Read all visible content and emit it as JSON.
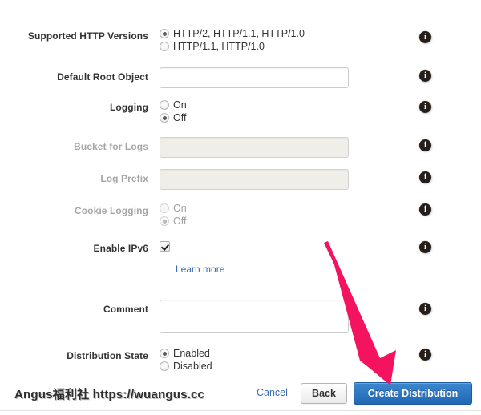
{
  "form": {
    "rows": [
      {
        "id": "supported-http-versions",
        "label": "Supported HTTP Versions",
        "type": "radio",
        "disabled": false,
        "options": [
          {
            "label": "HTTP/2, HTTP/1.1, HTTP/1.0",
            "selected": true
          },
          {
            "label": "HTTP/1.1, HTTP/1.0",
            "selected": false
          }
        ]
      },
      {
        "id": "default-root-object",
        "label": "Default Root Object",
        "type": "text",
        "value": "",
        "placeholder": "",
        "disabled": false
      },
      {
        "id": "logging",
        "label": "Logging",
        "type": "radio",
        "disabled": false,
        "options": [
          {
            "label": "On",
            "selected": false
          },
          {
            "label": "Off",
            "selected": true
          }
        ]
      },
      {
        "id": "bucket-for-logs",
        "label": "Bucket for Logs",
        "type": "text",
        "value": "",
        "placeholder": "",
        "disabled": true
      },
      {
        "id": "log-prefix",
        "label": "Log Prefix",
        "type": "text",
        "value": "",
        "placeholder": "",
        "disabled": true
      },
      {
        "id": "cookie-logging",
        "label": "Cookie Logging",
        "type": "radio",
        "disabled": true,
        "options": [
          {
            "label": "On",
            "selected": false
          },
          {
            "label": "Off",
            "selected": true
          }
        ]
      },
      {
        "id": "enable-ipv6",
        "label": "Enable IPv6",
        "type": "checkbox",
        "checked": true,
        "disabled": false,
        "help_link": "Learn more"
      },
      {
        "id": "comment",
        "label": "Comment",
        "type": "textarea",
        "value": "",
        "placeholder": "",
        "disabled": false
      },
      {
        "id": "distribution-state",
        "label": "Distribution State",
        "type": "radio",
        "disabled": false,
        "options": [
          {
            "label": "Enabled",
            "selected": true
          },
          {
            "label": "Disabled",
            "selected": false
          }
        ]
      }
    ],
    "info_icon_glyph": "i",
    "info_icon_name": "info-icon"
  },
  "footer": {
    "cancel_label": "Cancel",
    "back_label": "Back",
    "create_label": "Create Distribution",
    "watermark": "Angus福利社 https://wuangus.cc"
  },
  "annotation": {
    "type": "arrow",
    "color": "#F4135E",
    "points_to": "create-distribution-button"
  },
  "colors": {
    "primary_button": "#2a72bd",
    "link": "#3b6bb5",
    "label": "#333333",
    "label_disabled": "#a6a6a6",
    "arrow": "#F4135E",
    "disabled_input_bg": "#efeee9"
  }
}
